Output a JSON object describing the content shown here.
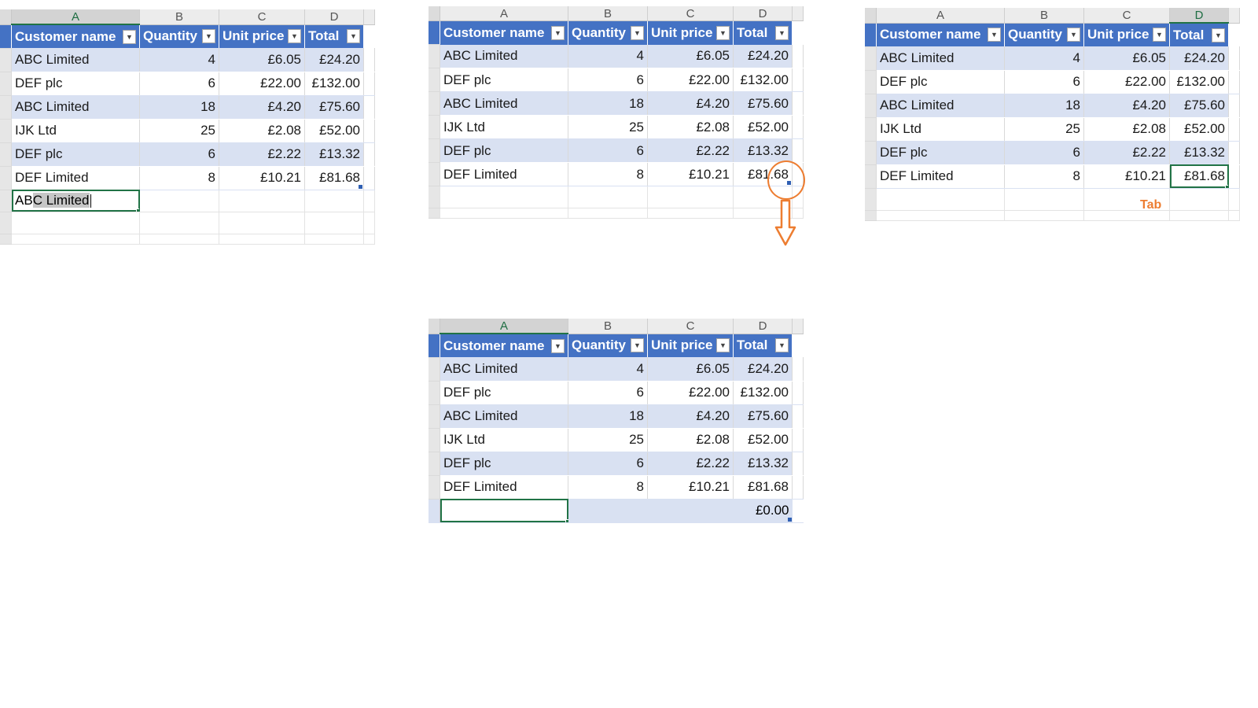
{
  "columns": [
    "A",
    "B",
    "C",
    "D"
  ],
  "headers": [
    {
      "label": "Customer name"
    },
    {
      "label": "Quantity"
    },
    {
      "label": "Unit price"
    },
    {
      "label": "Total"
    }
  ],
  "rows": [
    {
      "customer": "ABC Limited",
      "quantity": "4",
      "unit_price": "£6.05",
      "total": "£24.20"
    },
    {
      "customer": "DEF plc",
      "quantity": "6",
      "unit_price": "£22.00",
      "total": "£132.00"
    },
    {
      "customer": "ABC Limited",
      "quantity": "18",
      "unit_price": "£4.20",
      "total": "£75.60"
    },
    {
      "customer": "IJK Ltd",
      "quantity": "25",
      "unit_price": "£2.08",
      "total": "£52.00"
    },
    {
      "customer": "DEF plc",
      "quantity": "6",
      "unit_price": "£2.22",
      "total": "£13.32"
    },
    {
      "customer": "DEF Limited",
      "quantity": "8",
      "unit_price": "£10.21",
      "total": "£81.68"
    }
  ],
  "panel1": {
    "typed_prefix": "AB",
    "typed_selected": "C Limited"
  },
  "panel3": {
    "tab_label": "Tab"
  },
  "panel4": {
    "new_row_total": "£0.00"
  },
  "colors": {
    "table_header": "#4472c4",
    "band": "#d9e1f2",
    "active_cell": "#217346",
    "annotation": "#ed7d31"
  },
  "icons": {
    "filter": "dropdown-arrow-icon",
    "annotation_circle": "circle-highlight",
    "annotation_arrow": "down-arrow-icon"
  }
}
